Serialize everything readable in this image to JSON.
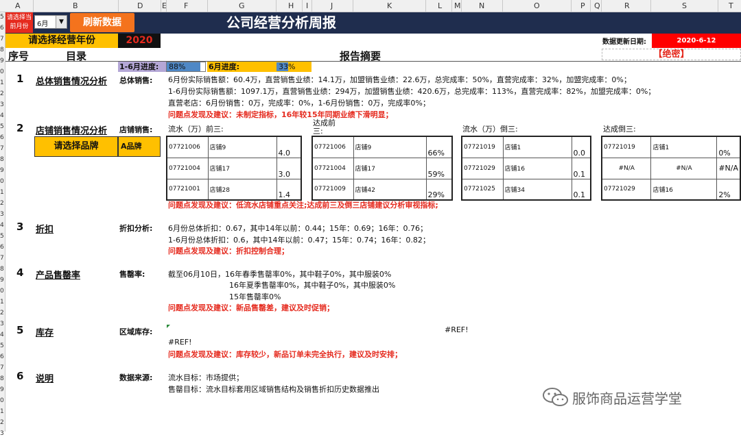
{
  "columns": [
    "A",
    "B",
    "D",
    "E",
    "F",
    "G",
    "H",
    "I",
    "J",
    "K",
    "L",
    "M",
    "N",
    "O",
    "P",
    "Q",
    "R",
    "S",
    "T"
  ],
  "rows": [
    "5",
    "6",
    "7",
    "8",
    "9",
    "0",
    "1",
    "2",
    "3",
    "4",
    "5",
    "6",
    "7",
    "8",
    "9",
    "0",
    "1",
    "2",
    "3",
    "4",
    "5",
    "6",
    "7",
    "8",
    "9",
    "0",
    "1",
    "2",
    "3",
    "4",
    "5",
    "6",
    "7",
    "8",
    "9",
    "0",
    "1",
    "2",
    "3"
  ],
  "toolbar": {
    "select_label": "请选择当前月份",
    "month_value": "6月",
    "refresh_label": "刷新数据",
    "title": "公司经营分析周报"
  },
  "year": {
    "label": "请选择经营年份",
    "value": "2020"
  },
  "update": {
    "label": "数据更新日期:",
    "value": "2020-6-12"
  },
  "header": {
    "seq": "序号",
    "catalog": "目录",
    "summary": "报告摘要",
    "secret": "【绝密】"
  },
  "progress": {
    "ytd_label": "1-6月进度:",
    "ytd_value": "88%",
    "ytd_fraction": 0.88,
    "month_label": "6月进度:",
    "month_value": "33%",
    "month_fraction": 0.33
  },
  "sections": {
    "s1": {
      "num": "1",
      "title": "总体销售情况分析",
      "sub": "总体销售:",
      "lines": [
        "6月份实际销售额：60.4万，直营销售业绩：14.1万，加盟销售业绩：22.6万，总完成率：50%，直营完成率：32%，加盟完成率：0%；",
        "1-6月份实际销售额：1097.1万，直营销售业绩：294万，加盟销售业绩：420.6万，总完成率：113%，直营完成率：82%，加盟完成率：0%；",
        "直营老店：6月份销售：0万，完成率：0%，1-6月份销售：0万，完成率0%；"
      ],
      "issue": "问题点发现及建议：未制定指标，16年较15年同期业绩下滑明显；"
    },
    "s2": {
      "num": "2",
      "title": "店铺销售情况分析",
      "sub": "店铺销售:",
      "brand_label": "请选择品牌",
      "brand_value": "A品牌",
      "heading_top3": "流水（万）前三:",
      "heading_rate_top3": "达成前三:",
      "heading_bottom3": "流水（万）倒三:",
      "heading_rate_bottom3": "达成倒三:",
      "top3": [
        [
          "07721006",
          "店铺9",
          "4.0"
        ],
        [
          "07721004",
          "店铺17",
          "3.0"
        ],
        [
          "07721001",
          "店铺28",
          "1.4"
        ]
      ],
      "rate_top3": [
        [
          "07721006",
          "店铺9",
          "66%"
        ],
        [
          "07721004",
          "店铺17",
          "59%"
        ],
        [
          "07721009",
          "店铺42",
          "29%"
        ]
      ],
      "bottom3": [
        [
          "07721019",
          "店铺1",
          "0.0"
        ],
        [
          "07721029",
          "店铺16",
          "0.1"
        ],
        [
          "07721025",
          "店铺34",
          "0.1"
        ]
      ],
      "rate_bottom3": [
        [
          "07721019",
          "店铺1",
          "0%"
        ],
        [
          "#N/A",
          "#N/A",
          "#N/A"
        ],
        [
          "07721029",
          "店铺16",
          "2%"
        ]
      ],
      "issue": "问题点发现及建议：低流水店铺重点关注;达成前三及倒三店铺建议分析审视指标;"
    },
    "s3": {
      "num": "3",
      "title": "折扣",
      "sub": "折扣分析:",
      "lines": [
        "6月份总体折扣：0.67，其中14年以前：0.44；15年：0.69；16年：0.76；",
        "1-6月份总体折扣：0.6，其中14年以前：0.47；15年：0.74；16年：0.82；"
      ],
      "issue": "问题点发现及建议：折扣控制合理；"
    },
    "s4": {
      "num": "4",
      "title": "产品售罄率",
      "sub": "售罄率:",
      "lines": [
        "截至06月10日，16年春季售罄率0%，其中鞋子0%，其中服装0%",
        "16年夏季售罄率0%，其中鞋子0%，其中服装0%",
        "15年售罄率0%"
      ],
      "issue": "问题点发现及建议：新品售罄差，建议及时促销；"
    },
    "s5": {
      "num": "5",
      "title": "库存",
      "sub": "区域库存:",
      "ref1": "#REF!",
      "ref2": "#REF!",
      "issue": "问题点发现及建议：库存较少，新品订单未完全执行，建议及时安排；"
    },
    "s6": {
      "num": "6",
      "title": "说明",
      "sub": "数据来源:",
      "lines": [
        "流水目标：市场提供；",
        "售罄目标：流水目标套用区域销售结构及销售折扣历史数据推出"
      ]
    }
  },
  "watermark": "服饰商品运营学堂"
}
